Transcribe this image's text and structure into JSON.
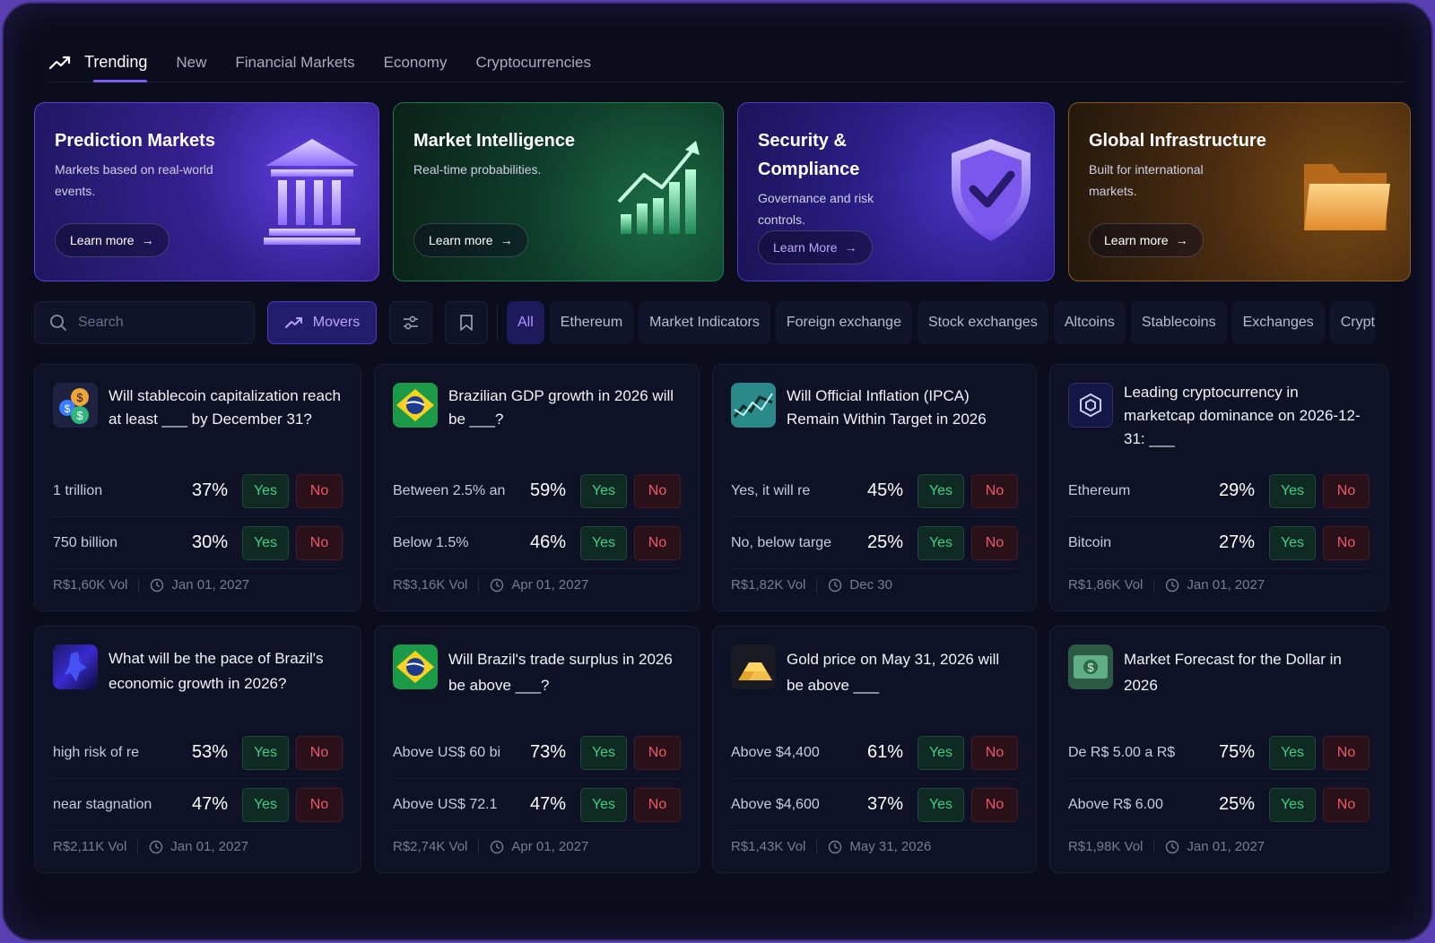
{
  "nav": {
    "tabs": [
      {
        "label": "Trending",
        "active": true
      },
      {
        "label": "New"
      },
      {
        "label": "Financial Markets"
      },
      {
        "label": "Economy"
      },
      {
        "label": "Cryptocurrencies"
      }
    ]
  },
  "heroes": [
    {
      "title": "Prediction Markets",
      "desc": "Markets based on real-world events.",
      "button": "Learn more",
      "icon": "bank-building-icon"
    },
    {
      "title": "Market Intelligence",
      "desc": "Real-time probabilities.",
      "button": "Learn more",
      "icon": "growth-chart-icon"
    },
    {
      "title": "Security & Compliance",
      "desc": "Governance and risk controls.",
      "button": "Learn More",
      "icon": "shield-check-icon"
    },
    {
      "title": "Global Infrastructure",
      "desc": "Built for international markets.",
      "button": "Learn more",
      "icon": "folder-icon"
    }
  ],
  "toolbar": {
    "search_placeholder": "Search",
    "movers_label": "Movers",
    "chips": [
      "All",
      "Ethereum",
      "Market Indicators",
      "Foreign exchange",
      "Stock exchanges",
      "Altcoins",
      "Stablecoins",
      "Exchanges",
      "Crypt"
    ]
  },
  "markets": [
    {
      "question": "Will stablecoin capitalization reach at least ___ by December 31?",
      "thumb": "coins-icon",
      "outcomes": [
        {
          "label": "1 trillion",
          "pct": "37%"
        },
        {
          "label": "750 billion",
          "pct": "30%"
        }
      ],
      "volume": "R$1,60K Vol",
      "date": "Jan 01, 2027"
    },
    {
      "question": "Brazilian GDP growth in 2026 will be ___?",
      "thumb": "brazil-flag-icon",
      "outcomes": [
        {
          "label": "Between 2.5% an",
          "pct": "59%"
        },
        {
          "label": "Below 1.5%",
          "pct": "46%"
        }
      ],
      "volume": "R$3,16K Vol",
      "date": "Apr 01, 2027"
    },
    {
      "question": "Will Official Inflation (IPCA) Remain Within Target in 2026",
      "thumb": "chart-line-icon",
      "outcomes": [
        {
          "label": "Yes, it will re",
          "pct": "45%"
        },
        {
          "label": "No, below targe",
          "pct": "25%"
        }
      ],
      "volume": "R$1,82K Vol",
      "date": "Dec 30"
    },
    {
      "question": "Leading cryptocurrency in marketcap dominance on 2026-12-31: ___",
      "thumb": "hexagon-icon",
      "outcomes": [
        {
          "label": "Ethereum",
          "pct": "29%"
        },
        {
          "label": "Bitcoin",
          "pct": "27%"
        }
      ],
      "volume": "R$1,86K Vol",
      "date": "Jan 01, 2027"
    },
    {
      "question": "What will be the pace of Brazil's economic growth in 2026?",
      "thumb": "abstract-blue-icon",
      "outcomes": [
        {
          "label": "high risk of re",
          "pct": "53%"
        },
        {
          "label": "near stagnation",
          "pct": "47%"
        }
      ],
      "volume": "R$2,11K Vol",
      "date": "Jan 01, 2027"
    },
    {
      "question": "Will Brazil's trade surplus in 2026 be above ___?",
      "thumb": "brazil-flag-icon",
      "outcomes": [
        {
          "label": "Above US$ 60 bi",
          "pct": "73%"
        },
        {
          "label": "Above US$ 72.1",
          "pct": "47%"
        }
      ],
      "volume": "R$2,74K Vol",
      "date": "Apr 01, 2027"
    },
    {
      "question": "Gold price on May 31, 2026 will be above ___",
      "thumb": "gold-bars-icon",
      "outcomes": [
        {
          "label": "Above $4,400",
          "pct": "61%"
        },
        {
          "label": "Above $4,600",
          "pct": "37%"
        }
      ],
      "volume": "R$1,43K Vol",
      "date": "May 31, 2026"
    },
    {
      "question": "Market Forecast for the Dollar in 2026",
      "thumb": "dollar-bill-icon",
      "outcomes": [
        {
          "label": "De R$ 5.00 a R$",
          "pct": "75%"
        },
        {
          "label": "Above R$ 6.00",
          "pct": "25%"
        }
      ],
      "volume": "R$1,98K Vol",
      "date": "Jan 01, 2027"
    }
  ],
  "labels": {
    "yes": "Yes",
    "no": "No"
  },
  "colors": {
    "accent": "#7c5cf5",
    "yes": "#3fcf86",
    "no": "#f0566c",
    "background": "#0b0d1c"
  }
}
